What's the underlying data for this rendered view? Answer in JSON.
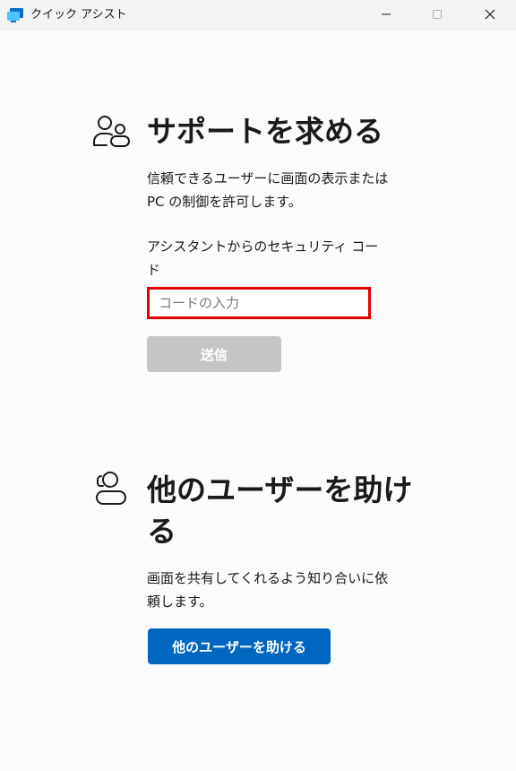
{
  "window": {
    "title": "クイック アシスト",
    "minimize_icon": "minimize-icon",
    "maximize_icon": "maximize-icon",
    "close_icon": "close-icon"
  },
  "get_help": {
    "icon": "people-icon",
    "title": "サポートを求める",
    "description_line1": "信頼できるユーザーに画面の表示または",
    "description_line2": "PC の制御を許可します。",
    "code_label_line1": "アシスタントからのセキュリティ コー",
    "code_label_line2": "ド",
    "code_input": {
      "value": "",
      "placeholder": "コードの入力"
    },
    "submit_label": "送信"
  },
  "give_help": {
    "icon": "helper-icon",
    "title_line1": "他のユーザーを助け",
    "title_line2": "る",
    "description_line1": "画面を共有してくれるよう知り合いに依",
    "description_line2": "頼します。",
    "button_label": "他のユーザーを助ける"
  },
  "colors": {
    "accent": "#0067c0",
    "highlight_border": "#e30000",
    "disabled_button": "#c5c5c5"
  }
}
